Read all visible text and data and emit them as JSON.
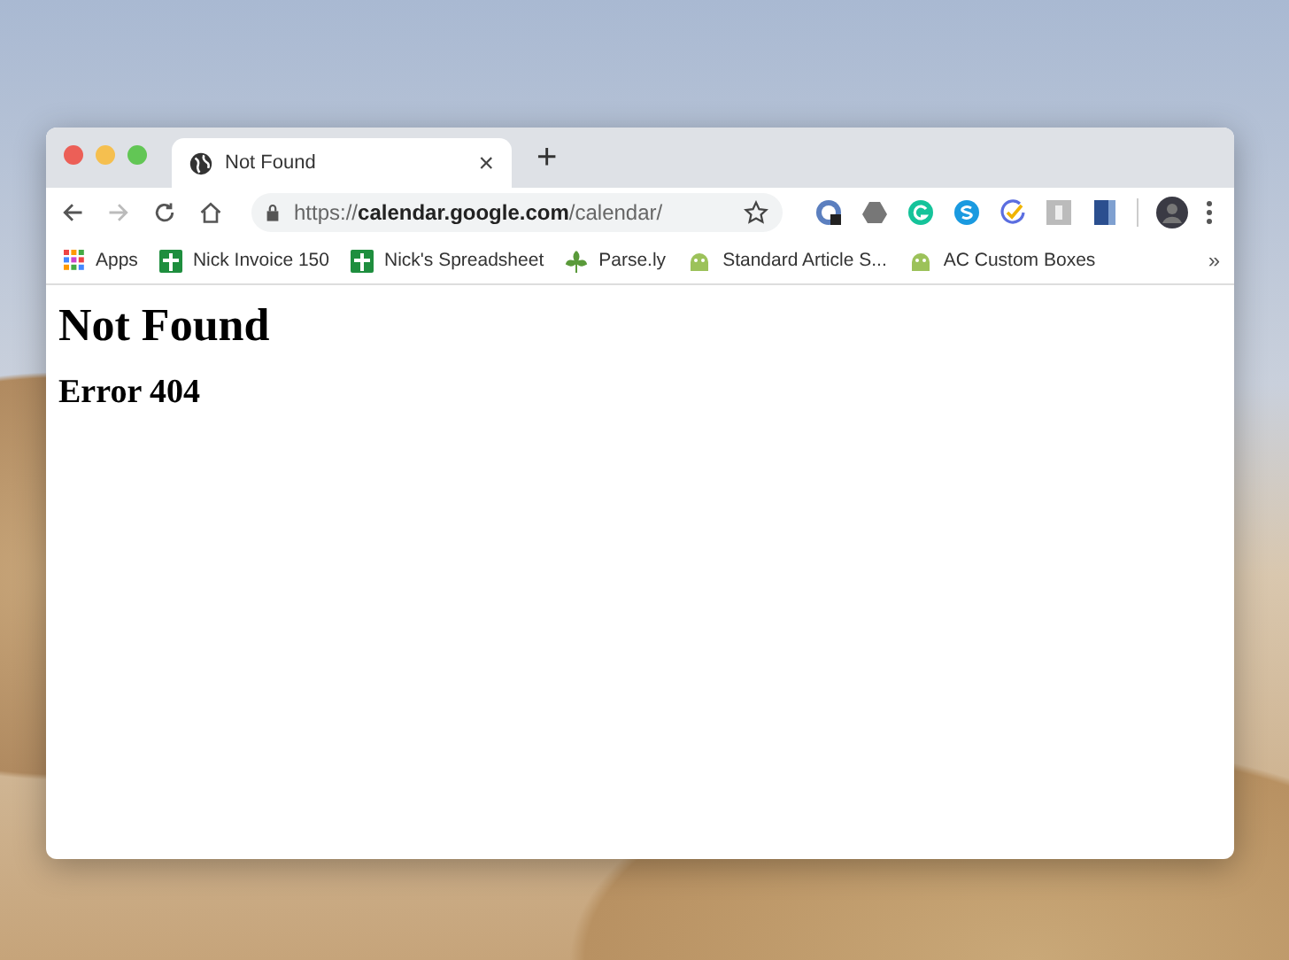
{
  "tabs": [
    {
      "title": "Not Found",
      "close": "×",
      "selected": true
    }
  ],
  "new_tab": "+",
  "address_bar": {
    "url": "https://**calendar.google.com**/calendar/"
  },
  "bookmarks": [
    {
      "kind": "apps",
      "label": "Apps"
    },
    {
      "kind": "sheets",
      "label": "Nick Invoice 150"
    },
    {
      "kind": "sheets",
      "label": "Nick's Spreadsheet"
    },
    {
      "kind": "leaf",
      "label": "Parse.ly"
    },
    {
      "kind": "android",
      "label": "Standard Article S..."
    },
    {
      "kind": "android",
      "label": "AC Custom Boxes"
    }
  ],
  "bookmarks_overflow": "»",
  "page": {
    "heading": "Not Found",
    "subheading": "Error 404"
  }
}
